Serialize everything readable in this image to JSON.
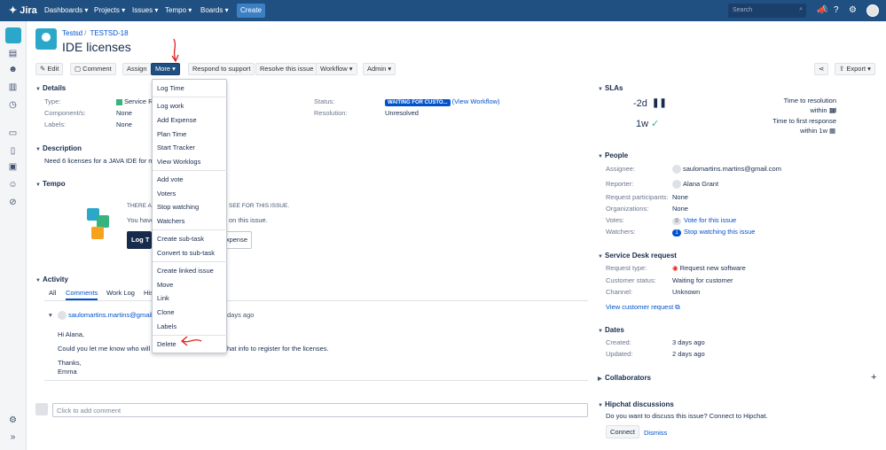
{
  "nav": {
    "logo": "Jira",
    "items": [
      "Dashboards ▾",
      "Projects ▾",
      "Issues ▾",
      "Tempo ▾",
      "Boards ▾"
    ],
    "create": "Create",
    "search_placeholder": "Search",
    "icons": [
      "search-icon",
      "megaphone-icon",
      "help-icon",
      "settings-icon",
      "avatar"
    ]
  },
  "breadcrumb": {
    "project": "Testsd",
    "issue_key": "TESTSD-18"
  },
  "issue": {
    "title": "IDE licenses"
  },
  "toolbar": {
    "edit": "Edit",
    "comment": "Comment",
    "assign": "Assign",
    "more": "More",
    "respond": "Respond to support",
    "resolve": "Resolve this issue",
    "workflow": "Workflow",
    "admin": "Admin",
    "export": "Export"
  },
  "details": {
    "heading": "Details",
    "type_label": "Type:",
    "type_value": "Service R",
    "components_label": "Component/s:",
    "components_value": "None",
    "labels_label": "Labels:",
    "labels_value": "None",
    "status_label": "Status:",
    "status_value": "WAITING FOR CUSTO...",
    "status_workflow": "(View Workflow)",
    "resolution_label": "Resolution:",
    "resolution_value": "Unresolved"
  },
  "description": {
    "heading": "Description",
    "text": "Need 6 licenses for a JAVA IDE for my"
  },
  "tempo": {
    "heading": "Tempo",
    "line1_left": "THERE AR",
    "line1_right": "SEE FOR THIS ISSUE.",
    "line2_left": "You have",
    "line2_right": "on this issue.",
    "log_button": "Log T",
    "expense_button": "xpense"
  },
  "more_menu": {
    "items": [
      "Log Time",
      "Log work",
      "Add Expense",
      "Plan Time",
      "Start Tracker",
      "View Worklogs",
      "Add vote",
      "Voters",
      "Stop watching",
      "Watchers",
      "Create sub-task",
      "Convert to sub-task",
      "Create linked issue",
      "Move",
      "Link",
      "Clone",
      "Labels",
      "Delete"
    ]
  },
  "activity": {
    "heading": "Activity",
    "tabs": [
      "All",
      "Comments",
      "Work Log",
      "His"
    ],
    "comment_author": "saulomartins.martins@gmail.co",
    "comment_time": "days ago",
    "comment_lines": [
      "Hi Alana,",
      "Could you let me know who will",
      "hat info to register for the licenses.",
      "Thanks,",
      "Emma"
    ],
    "add_comment_placeholder": "Click to add comment"
  },
  "sla": {
    "heading": "SLAs",
    "first_value": "-2d",
    "first_label": "Time to resolution",
    "first_target": "within 1d",
    "second_value": "1w",
    "second_label": "Time to first response",
    "second_target": "within 1w"
  },
  "people": {
    "heading": "People",
    "assignee_label": "Assignee:",
    "assignee_value": "saulomartins.martins@gmail.com",
    "reporter_label": "Reporter:",
    "reporter_value": "Alana Grant",
    "participants_label": "Request participants:",
    "participants_value": "None",
    "orgs_label": "Organizations:",
    "orgs_value": "None",
    "votes_label": "Votes:",
    "votes_count": "0",
    "votes_link": "Vote for this issue",
    "watchers_label": "Watchers:",
    "watchers_count": "1",
    "watchers_link": "Stop watching this issue"
  },
  "service_desk": {
    "heading": "Service Desk request",
    "type_label": "Request type:",
    "type_value": "Request new software",
    "status_label": "Customer status:",
    "status_value": "Waiting for customer",
    "channel_label": "Channel:",
    "channel_value": "Unknown",
    "view_link": "View customer request"
  },
  "dates": {
    "heading": "Dates",
    "created_label": "Created:",
    "created_value": "3 days ago",
    "updated_label": "Updated:",
    "updated_value": "2 days ago"
  },
  "collaborators": {
    "heading": "Collaborators",
    "add": "+"
  },
  "hipchat": {
    "heading": "Hipchat discussions",
    "text": "Do you want to discuss this issue? Connect to Hipchat.",
    "connect": "Connect",
    "dismiss": "Dismiss"
  },
  "colors": {
    "nav": "#205081",
    "link": "#0052cc",
    "annotation": "#e0201b"
  }
}
